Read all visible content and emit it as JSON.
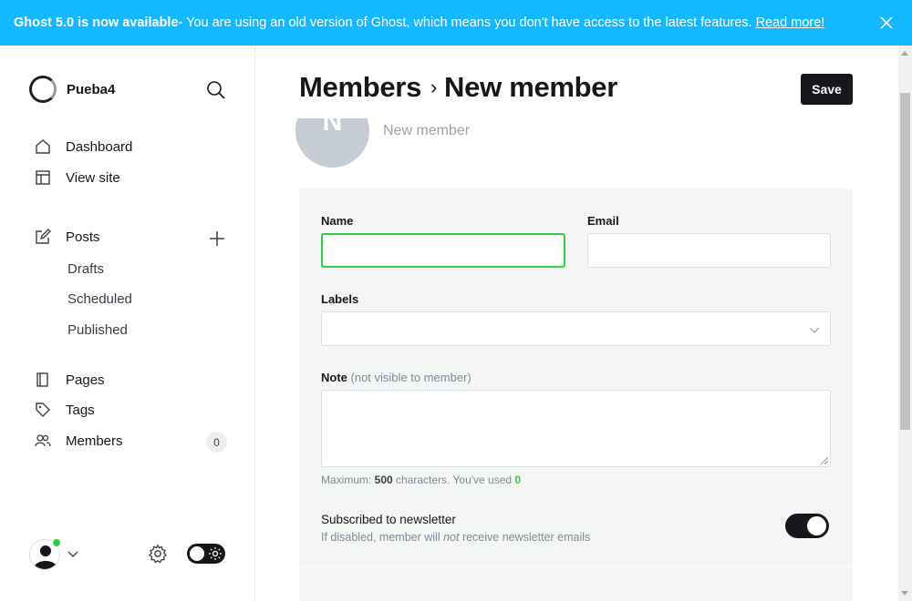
{
  "banner": {
    "headline": "Ghost 5.0 is now available",
    "message": " - You are using an old version of Ghost, which means you don't have access to the latest features.",
    "link": "Read more!"
  },
  "sidebar": {
    "site_name": "Pueba4",
    "nav": [
      {
        "label": "Dashboard"
      },
      {
        "label": "View site"
      },
      {
        "label": "Posts"
      },
      {
        "label": "Drafts"
      },
      {
        "label": "Scheduled"
      },
      {
        "label": "Published"
      },
      {
        "label": "Pages"
      },
      {
        "label": "Tags"
      },
      {
        "label": "Members"
      }
    ],
    "members_count": "0"
  },
  "header": {
    "breadcrumb_parent": "Members",
    "separator": "›",
    "title": "New member",
    "save_label": "Save"
  },
  "member": {
    "avatar_initial": "N",
    "display_name": "New member"
  },
  "form": {
    "name_label": "Name",
    "name_value": "",
    "email_label": "Email",
    "email_value": "",
    "labels_label": "Labels",
    "note_label": "Note",
    "note_sub": "(not visible to member)",
    "hint_prefix": "Maximum: ",
    "hint_max": "500",
    "hint_middle": " characters. You've used ",
    "hint_used": "0",
    "newsletter_title": "Subscribed to newsletter",
    "newsletter_desc_1": "If disabled, member will ",
    "newsletter_desc_em": "not",
    "newsletter_desc_2": " receive newsletter emails",
    "subscribed": true
  }
}
